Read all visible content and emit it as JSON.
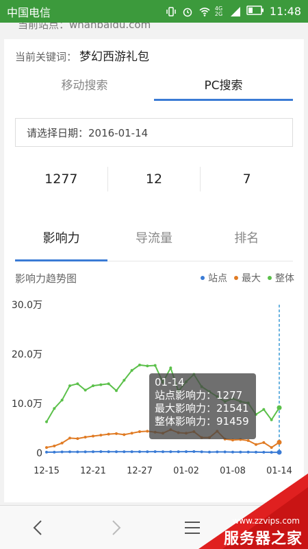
{
  "status_bar": {
    "carrier": "中国电信",
    "time": "11:48",
    "network": "4G 2G"
  },
  "page": {
    "url_peek": "当前站点：whanbaidu.com"
  },
  "keyword": {
    "label": "当前关键词：",
    "value": "梦幻西游礼包"
  },
  "source_tabs": [
    {
      "label": "移动搜索",
      "active": false
    },
    {
      "label": "PC搜索",
      "active": true
    }
  ],
  "date_select": {
    "text": "请选择日期：2016-01-14"
  },
  "stats": [
    "1277",
    "12",
    "7"
  ],
  "metric_tabs": [
    {
      "label": "影响力",
      "active": true
    },
    {
      "label": "导流量",
      "active": false
    },
    {
      "label": "排名",
      "active": false
    }
  ],
  "chart_title": "影响力趋势图",
  "chart_data": {
    "type": "line",
    "ylabels": [
      "0",
      "10.0万",
      "20.0万",
      "30.0万"
    ],
    "ylim": [
      0,
      300000
    ],
    "xtick_labels": [
      "12-15",
      "12-21",
      "12-27",
      "01-02",
      "01-08",
      "01-14"
    ],
    "x": [
      "12-15",
      "12-16",
      "12-17",
      "12-18",
      "12-19",
      "12-20",
      "12-21",
      "12-22",
      "12-23",
      "12-24",
      "12-25",
      "12-26",
      "12-27",
      "12-28",
      "12-29",
      "12-30",
      "12-31",
      "01-01",
      "01-02",
      "01-03",
      "01-04",
      "01-05",
      "01-06",
      "01-07",
      "01-08",
      "01-09",
      "01-10",
      "01-11",
      "01-12",
      "01-13",
      "01-14"
    ],
    "series": [
      {
        "name": "站点",
        "color": "#3a7bd5",
        "values": [
          1500,
          1600,
          2000,
          2200,
          2000,
          2300,
          2400,
          2600,
          2500,
          2500,
          2400,
          2400,
          2500,
          2400,
          2600,
          2500,
          2400,
          2500,
          2600,
          2800,
          2200,
          1800,
          2000,
          2100,
          1800,
          1700,
          1700,
          1500,
          1400,
          1300,
          1277
        ]
      },
      {
        "name": "最大",
        "color": "#e07b24",
        "values": [
          11000,
          14000,
          20000,
          30000,
          29000,
          32000,
          34000,
          36000,
          38000,
          39000,
          37000,
          40000,
          43000,
          44000,
          42000,
          40000,
          47000,
          41000,
          40000,
          43000,
          31000,
          31000,
          44000,
          28000,
          26000,
          27000,
          25000,
          17000,
          21000,
          11000,
          21541
        ]
      },
      {
        "name": "整体",
        "color": "#5bc04a",
        "values": [
          63000,
          90000,
          107000,
          136000,
          140000,
          127000,
          136000,
          138000,
          140000,
          126000,
          147000,
          167000,
          178000,
          176000,
          177000,
          143000,
          172000,
          125000,
          144000,
          159000,
          134000,
          124000,
          114000,
          104000,
          110000,
          104000,
          101000,
          78000,
          88000,
          67000,
          91459
        ]
      }
    ],
    "legend_position": "top-right",
    "highlight_index": 30,
    "tooltip": {
      "date": "01-14",
      "lines": [
        "站点影响力：1277",
        "最大影响力：21541",
        "整体影响力：91459"
      ]
    }
  },
  "bottom_nav": [
    "back-icon",
    "forward-icon",
    "menu-icon",
    "tabs-icon"
  ],
  "watermark": {
    "url": "www.zzvips.com",
    "name": "服务器之家"
  }
}
